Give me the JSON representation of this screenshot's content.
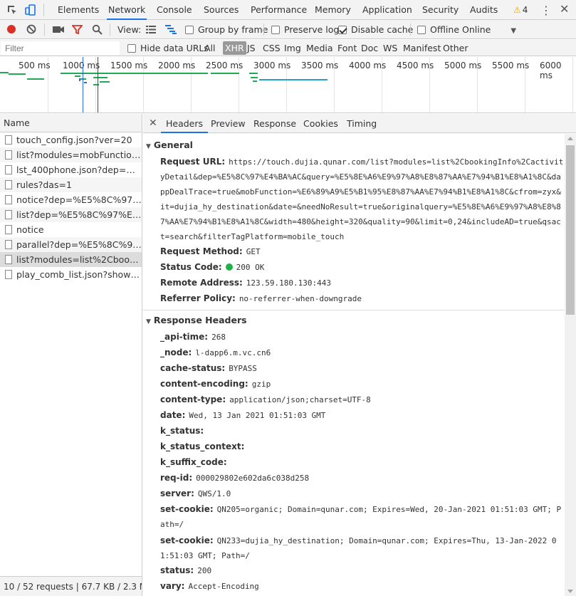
{
  "top_tabs": [
    {
      "label": "Elements"
    },
    {
      "label": "Network"
    },
    {
      "label": "Console"
    },
    {
      "label": "Sources"
    },
    {
      "label": "Performance"
    },
    {
      "label": "Memory"
    },
    {
      "label": "Application"
    },
    {
      "label": "Security"
    },
    {
      "label": "Audits"
    }
  ],
  "warnings_count": "4",
  "toolbar": {
    "view_label": "View:",
    "group_by_frame": "Group by frame",
    "preserve_log": "Preserve log",
    "disable_cache": "Disable cache",
    "offline": "Offline",
    "throttle": "Online"
  },
  "filter": {
    "placeholder": "Filter",
    "hide_data_urls": "Hide data URLs",
    "types": [
      "All",
      "XHR",
      "JS",
      "CSS",
      "Img",
      "Media",
      "Font",
      "Doc",
      "WS",
      "Manifest",
      "Other"
    ]
  },
  "timeline_ticks": [
    "500 ms",
    "1000 ms",
    "1500 ms",
    "2000 ms",
    "2500 ms",
    "3000 ms",
    "3500 ms",
    "4000 ms",
    "4500 ms",
    "5000 ms",
    "5500 ms",
    "6000 ms"
  ],
  "requests_header": "Name",
  "requests": [
    "touch_config.json?ver=20",
    "list?modules=mobFunction,co...",
    "lst_400phone.json?dep=%E5%...",
    "rules?das=1",
    "notice?dep=%E5%8C%97%E4...",
    "list?dep=%E5%8C%97%E4%B...",
    "notice",
    "parallel?dep=%E5%8C%97%E...",
    "list?modules=list%2CbookingI...",
    "play_comb_list.json?showMinLi..."
  ],
  "status_summary": "10 / 52 requests | 67.7 KB / 2.3 M...",
  "detail_tabs": [
    "Headers",
    "Preview",
    "Response",
    "Cookies",
    "Timing"
  ],
  "general": {
    "title": "General",
    "request_url_key": "Request URL:",
    "request_url": "https://touch.dujia.qunar.com/list?modules=list%2CbookingInfo%2CactivityDetail&dep=%E5%8C%97%E4%BA%AC&query=%E5%8E%A6%E9%97%A8%E8%87%AA%E7%94%B1%E8%A1%8C&dappDealTrace=true&mobFunction=%E6%89%A9%E5%B1%95%E8%87%AA%E7%94%B1%E8%A1%8C&cfrom=zyx&it=dujia_hy_destination&date=&needNoResult=true&originalquery=%E5%8E%A6%E9%97%A8%E8%87%AA%E7%94%B1%E8%A1%8C&width=480&height=320&quality=90&limit=0,24&includeAD=true&qsact=search&filterTagPlatform=mobile_touch",
    "request_method_key": "Request Method:",
    "request_method": "GET",
    "status_code_key": "Status Code:",
    "status_code": "200 OK",
    "remote_address_key": "Remote Address:",
    "remote_address": "123.59.180.130:443",
    "referrer_policy_key": "Referrer Policy:",
    "referrer_policy": "no-referrer-when-downgrade"
  },
  "response_headers": {
    "title": "Response Headers",
    "items": [
      {
        "k": "_api-time:",
        "v": "268"
      },
      {
        "k": "_node:",
        "v": "l-dapp6.m.vc.cn6"
      },
      {
        "k": "cache-status:",
        "v": "BYPASS"
      },
      {
        "k": "content-encoding:",
        "v": "gzip"
      },
      {
        "k": "content-type:",
        "v": "application/json;charset=UTF-8"
      },
      {
        "k": "date:",
        "v": "Wed, 13 Jan 2021 01:51:03 GMT"
      },
      {
        "k": "k_status:",
        "v": ""
      },
      {
        "k": "k_status_context:",
        "v": ""
      },
      {
        "k": "k_suffix_code:",
        "v": ""
      },
      {
        "k": "req-id:",
        "v": "000029802e602da6c038d258"
      },
      {
        "k": "server:",
        "v": "QWS/1.0"
      },
      {
        "k": "set-cookie:",
        "v": "QN205=organic; Domain=qunar.com; Expires=Wed, 20-Jan-2021 01:51:03 GMT; Path=/"
      },
      {
        "k": "set-cookie:",
        "v": "QN233=dujia_hy_destination; Domain=qunar.com; Expires=Thu, 13-Jan-2022 01:51:03 GMT; Path=/"
      },
      {
        "k": "status:",
        "v": "200"
      },
      {
        "k": "vary:",
        "v": "Accept-Encoding"
      }
    ]
  }
}
